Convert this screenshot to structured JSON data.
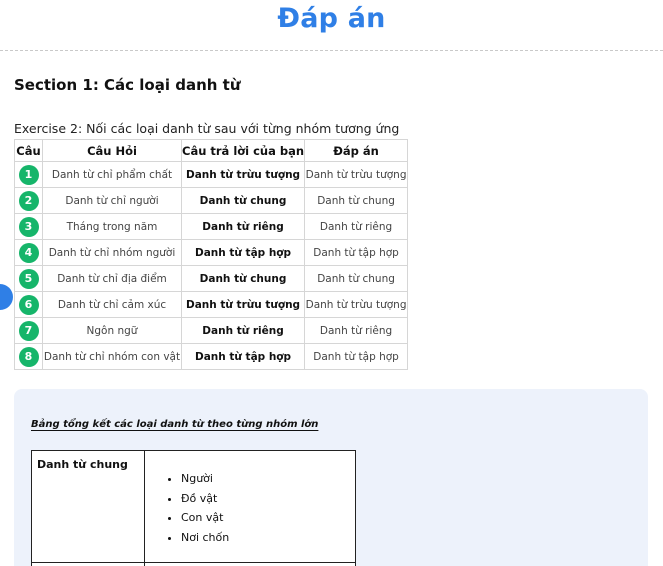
{
  "page": {
    "title": "Đáp án"
  },
  "section": {
    "heading": "Section 1: Các loại danh từ",
    "instruction": "Exercise 2: Nối các loại danh từ sau với từng nhóm tương ứng"
  },
  "answer_table": {
    "headers": [
      "Câu",
      "Câu Hỏi",
      "Câu trả lời của bạn",
      "Đáp án"
    ],
    "rows": [
      {
        "num": "1",
        "question": "Danh từ chỉ phẩm chất",
        "your_answer": "Danh từ trừu tượng",
        "answer": "Danh từ trừu tượng"
      },
      {
        "num": "2",
        "question": "Danh từ chỉ người",
        "your_answer": "Danh từ chung",
        "answer": "Danh từ chung"
      },
      {
        "num": "3",
        "question": "Tháng trong năm",
        "your_answer": "Danh từ riêng",
        "answer": "Danh từ riêng"
      },
      {
        "num": "4",
        "question": "Danh từ chỉ nhóm người",
        "your_answer": "Danh từ tập hợp",
        "answer": "Danh từ tập hợp"
      },
      {
        "num": "5",
        "question": "Danh từ chỉ địa điểm",
        "your_answer": "Danh từ chung",
        "answer": "Danh từ chung"
      },
      {
        "num": "6",
        "question": "Danh từ chỉ cảm xúc",
        "your_answer": "Danh từ trừu tượng",
        "answer": "Danh từ trừu tượng"
      },
      {
        "num": "7",
        "question": "Ngôn ngữ",
        "your_answer": "Danh từ riêng",
        "answer": "Danh từ riêng"
      },
      {
        "num": "8",
        "question": "Danh từ chỉ nhóm con vật",
        "your_answer": "Danh từ tập hợp",
        "answer": "Danh từ tập hợp"
      }
    ],
    "badge_color": "#16b56a"
  },
  "summary": {
    "heading": "Bảng tổng kết các loại danh từ theo từng nhóm lớn",
    "rows": [
      {
        "category": "Danh từ chung",
        "items": [
          "Người",
          "Đồ vật",
          "Con vật",
          "Nơi chốn"
        ]
      }
    ]
  },
  "colors": {
    "accent": "#2f7fe6",
    "panel_bg": "#edf2fb"
  }
}
